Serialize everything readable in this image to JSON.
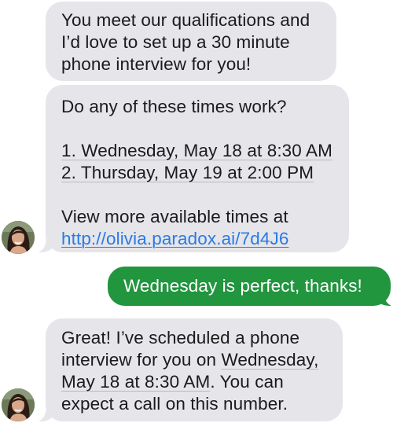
{
  "messages": [
    {
      "lines": [
        "You meet our qualifications and",
        "I’d love to set up a 30 minute",
        "phone interview for you!"
      ]
    },
    {
      "intro": "Do any of these times work?",
      "options": [
        "1. Wednesday, May 18 at 8:30 AM",
        "2. Thursday, May 19 at 2:00 PM"
      ],
      "more_text": "View more available times at",
      "link": "http://olivia.paradox.ai/7d4J6"
    },
    {
      "text": "Wednesday is perfect, thanks!"
    },
    {
      "line1": "Great! I’ve scheduled a phone",
      "line2_prefix": "interview for you on ",
      "line2_day": "Wednesday,",
      "line3_date": "May 18 at 8:30 AM",
      "line3_suffix": ". You can",
      "line4": "expect a call on this number."
    }
  ],
  "colors": {
    "incoming_bubble": "#e5e5ea",
    "outgoing_bubble": "#22953f",
    "link": "#2a7be4"
  },
  "icons": {
    "avatar": "recruiter-avatar"
  }
}
